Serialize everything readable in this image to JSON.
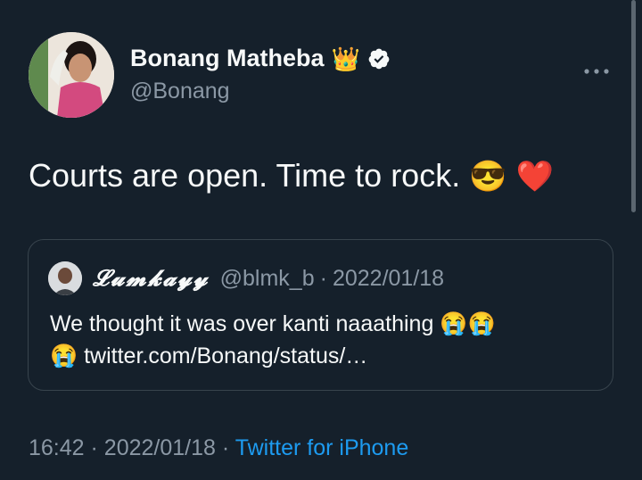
{
  "author": {
    "name": "Bonang Matheba",
    "crown_emoji": "👑",
    "handle": "@Bonang"
  },
  "tweet": {
    "text": "Courts are open. Time to rock.",
    "emoji_1": "😎",
    "emoji_2": "❤️"
  },
  "quote": {
    "name": "𝓛𝓾𝓶𝓴𝓪𝔂𝔂",
    "handle": "@blmk_b",
    "separator": "·",
    "date": "2022/01/18",
    "text_line1": "We thought it was over kanti naaathing",
    "crying_emoji": "😭",
    "link": "twitter.com/Bonang/status/…"
  },
  "footer": {
    "time": "16:42",
    "separator": "·",
    "date": "2022/01/18",
    "source": "Twitter for iPhone"
  },
  "more_icon": "more-horizontal-icon",
  "colors": {
    "background": "#15202b",
    "text": "#f7f9f9",
    "muted": "#8b98a5",
    "accent": "#1d9bf0",
    "border": "#38444d"
  }
}
